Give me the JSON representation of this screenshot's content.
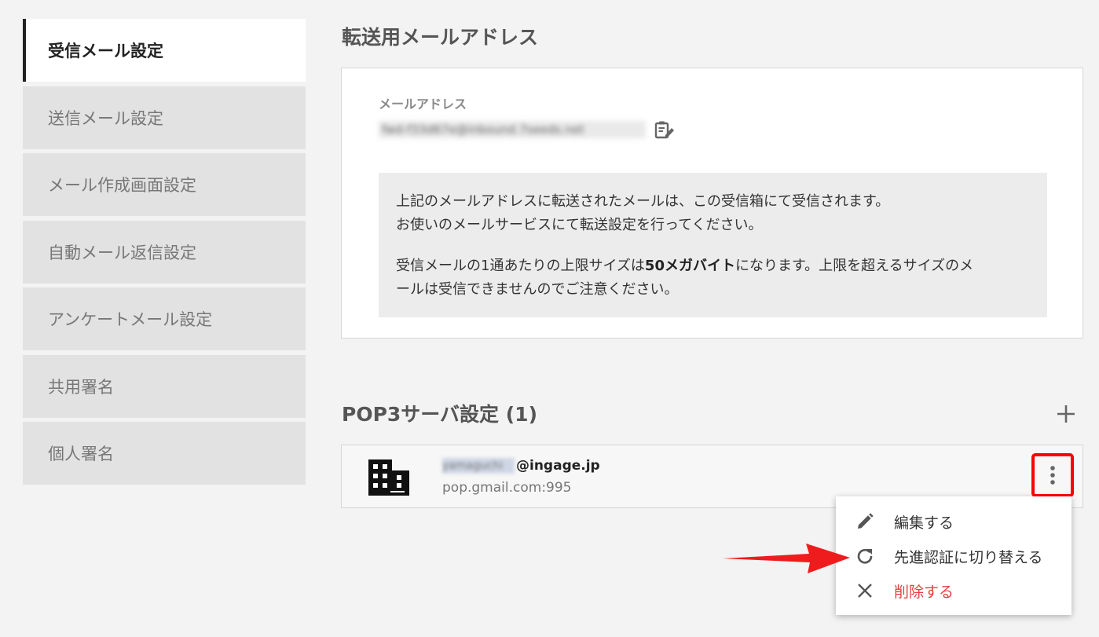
{
  "sidebar": {
    "items": [
      {
        "label": "受信メール設定",
        "active": true
      },
      {
        "label": "送信メール設定"
      },
      {
        "label": "メール作成画面設定"
      },
      {
        "label": "自動メール返信設定"
      },
      {
        "label": "アンケートメール設定"
      },
      {
        "label": "共用署名"
      },
      {
        "label": "個人署名"
      }
    ]
  },
  "forwarding": {
    "title": "転送用メールアドレス",
    "field_label": "メールアドレス",
    "email_value": "fwd-f33d67e@inbound.7seeds.net",
    "copy_icon": "clipboard-edit-icon",
    "notice": {
      "line1": "上記のメールアドレスに転送されたメールは、この受信箱にて受信されます。",
      "line2": "お使いのメールサービスにて転送設定を行ってください。",
      "line3_pre": "受信メールの1通あたりの上限サイズは",
      "line3_bold": "50メガバイト",
      "line3_post": "になります。上限を超えるサイズのメ",
      "line4": "ールは受信できませんのでご注意ください。"
    }
  },
  "pop3": {
    "title": "POP3サーバ設定 (1)",
    "add_icon": "plus-icon",
    "accounts": [
      {
        "user": "yamaguchi",
        "domain": "@ingage.jp",
        "server": "pop.gmail.com:995",
        "icon": "building-icon",
        "more_icon": "kebab-menu-icon"
      }
    ]
  },
  "context_menu": {
    "items": [
      {
        "label": "編集する",
        "icon": "pencil-icon"
      },
      {
        "label": "先進認証に切り替える",
        "icon": "refresh-icon"
      },
      {
        "label": "削除する",
        "icon": "close-icon",
        "danger": true
      }
    ]
  },
  "colors": {
    "danger": "#e0413e",
    "highlight": "#ff0000",
    "background": "#f3f3f3"
  }
}
